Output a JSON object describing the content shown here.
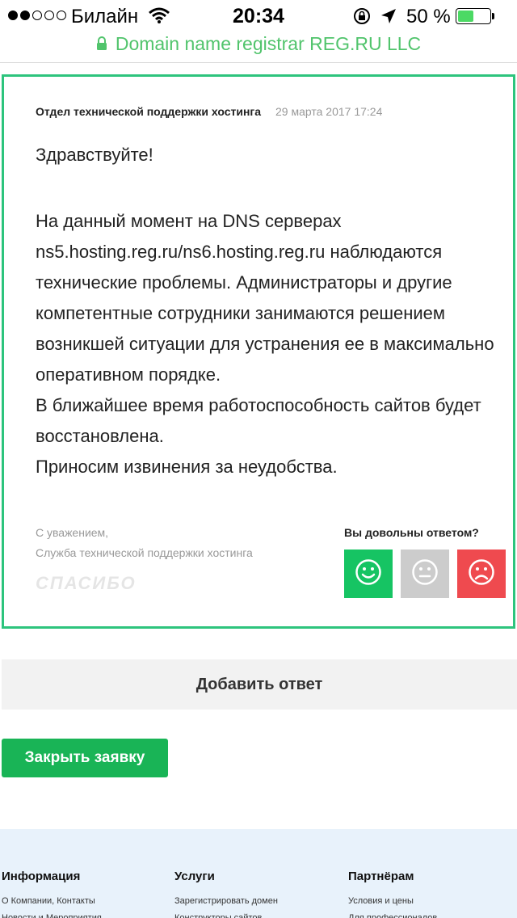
{
  "status_bar": {
    "carrier": "Билайн",
    "time": "20:34",
    "battery_percent": "50 %",
    "battery_level": 0.5,
    "signal_bars_filled": 2,
    "signal_bars_total": 5
  },
  "url_bar": {
    "site_identity": "Domain name registrar REG.RU LLC",
    "accent_color": "#51c46c"
  },
  "message": {
    "author": "Отдел технической поддержки хостинга",
    "date": "29 марта 2017 17:24",
    "greeting": "Здравствуйте!",
    "paragraphs": [
      "На данный момент на DNS серверах ns5.hosting.reg.ru/ns6.hosting.reg.ru наблюдаются технические проблемы. Администраторы и другие компетентные сотрудники занимаются решением возникшей ситуации для устранения ее в максимально оперативном порядке.",
      "В ближайшее время работоспособность сайтов будет восстановлена.",
      "Приносим извинения за неудобства."
    ],
    "signature_line1": "С уважением,",
    "signature_line2": "Служба технической поддержки хостинга",
    "thanks_stamp": "СПАСИБО",
    "border_color": "#2dc47d"
  },
  "rating": {
    "question": "Вы довольны ответом?",
    "options": [
      {
        "icon": "smile-icon",
        "color": "#16c463"
      },
      {
        "icon": "neutral-face-icon",
        "color": "#cccccc"
      },
      {
        "icon": "sad-face-icon",
        "color": "#ef4a4f"
      }
    ]
  },
  "actions": {
    "add_answer": "Добавить ответ",
    "close_ticket": "Закрыть заявку",
    "close_ticket_color": "#19b456"
  },
  "footer": {
    "columns": [
      {
        "title": "Информация",
        "links": [
          "О Компании, Контакты",
          "Новости и Мероприятия"
        ]
      },
      {
        "title": "Услуги",
        "links": [
          "Зарегистрировать домен",
          "Конструкторы сайтов"
        ]
      },
      {
        "title": "Партнёрам",
        "links": [
          "Условия и цены",
          "Для профессионалов"
        ]
      }
    ]
  }
}
